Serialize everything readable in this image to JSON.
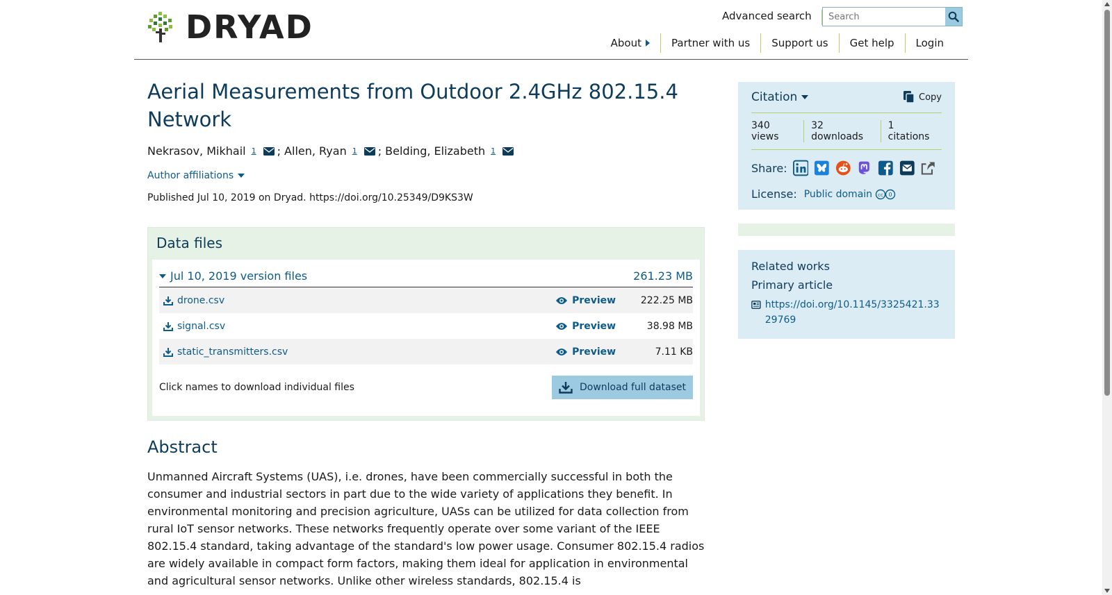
{
  "brand": {
    "name": "DRYAD"
  },
  "header": {
    "advanced_search": "Advanced search",
    "search_placeholder": "Search",
    "nav": [
      {
        "label": "About",
        "has_caret": true
      },
      {
        "label": "Partner with us"
      },
      {
        "label": "Support us"
      },
      {
        "label": "Get help"
      },
      {
        "label": "Login"
      }
    ]
  },
  "dataset": {
    "title": "Aerial Measurements from Outdoor 2.4GHz 802.15.4 Network",
    "authors": [
      {
        "name": "Nekrasov, Mikhail",
        "affiliation": "1"
      },
      {
        "name": "; Allen, Ryan",
        "affiliation": "1"
      },
      {
        "name": "; Belding, Elizabeth",
        "affiliation": "1"
      }
    ],
    "author_affiliations": "Author affiliations",
    "published": "Published Jul 10, 2019 on Dryad. https://doi.org/10.25349/D9KS3W"
  },
  "data_files": {
    "title": "Data files",
    "version_label": "Jul 10, 2019 version files",
    "version_size": "261.23 MB",
    "preview_label": "Preview",
    "files": [
      {
        "name": "drone.csv",
        "size": "222.25 MB"
      },
      {
        "name": "signal.csv",
        "size": "38.98 MB"
      },
      {
        "name": "static_transmitters.csv",
        "size": "7.11 KB"
      }
    ],
    "hint": "Click names to download individual files",
    "download_full": "Download full dataset"
  },
  "abstract": {
    "heading": "Abstract",
    "text": "Unmanned Aircraft Systems (UAS), i.e. drones, have been commercially successful in both the consumer and industrial sectors in part due to the wide variety of applications they benefit. In environmental monitoring and precision agriculture, UASs can be utilized for data collection from rural IoT sensor networks. These networks frequently operate over some variant of the IEEE 802.15.4 standard, taking advantage of the standard's low power usage. Consumer 802.15.4 radios are widely available in compact form factors, making them ideal for application in environmental and agricultural sensor networks. Unlike other wireless standards, 802.15.4 is"
  },
  "sidebar": {
    "citation_label": "Citation",
    "copy_label": "Copy",
    "metrics": {
      "views": "340 views",
      "downloads": "32 downloads",
      "citations": "1 citations"
    },
    "share_label": "Share:",
    "share_icons": [
      "linkedin-icon",
      "bluesky-icon",
      "reddit-icon",
      "mastodon-icon",
      "facebook-icon",
      "email-icon",
      "share-icon"
    ],
    "license_label": "License:",
    "license_value": "Public domain",
    "related_works": "Related works",
    "primary_article": "Primary article",
    "related_link": "https://doi.org/10.1145/3325421.3329769"
  },
  "colors": {
    "primary_blue": "#0d5b8a",
    "heading_blue": "#0d3b5a",
    "light_blue_panel": "#dcecf4",
    "light_green_panel": "#e6f2e6",
    "accent_green": "#b7cf6e",
    "button_blue": "#9ccae0"
  }
}
